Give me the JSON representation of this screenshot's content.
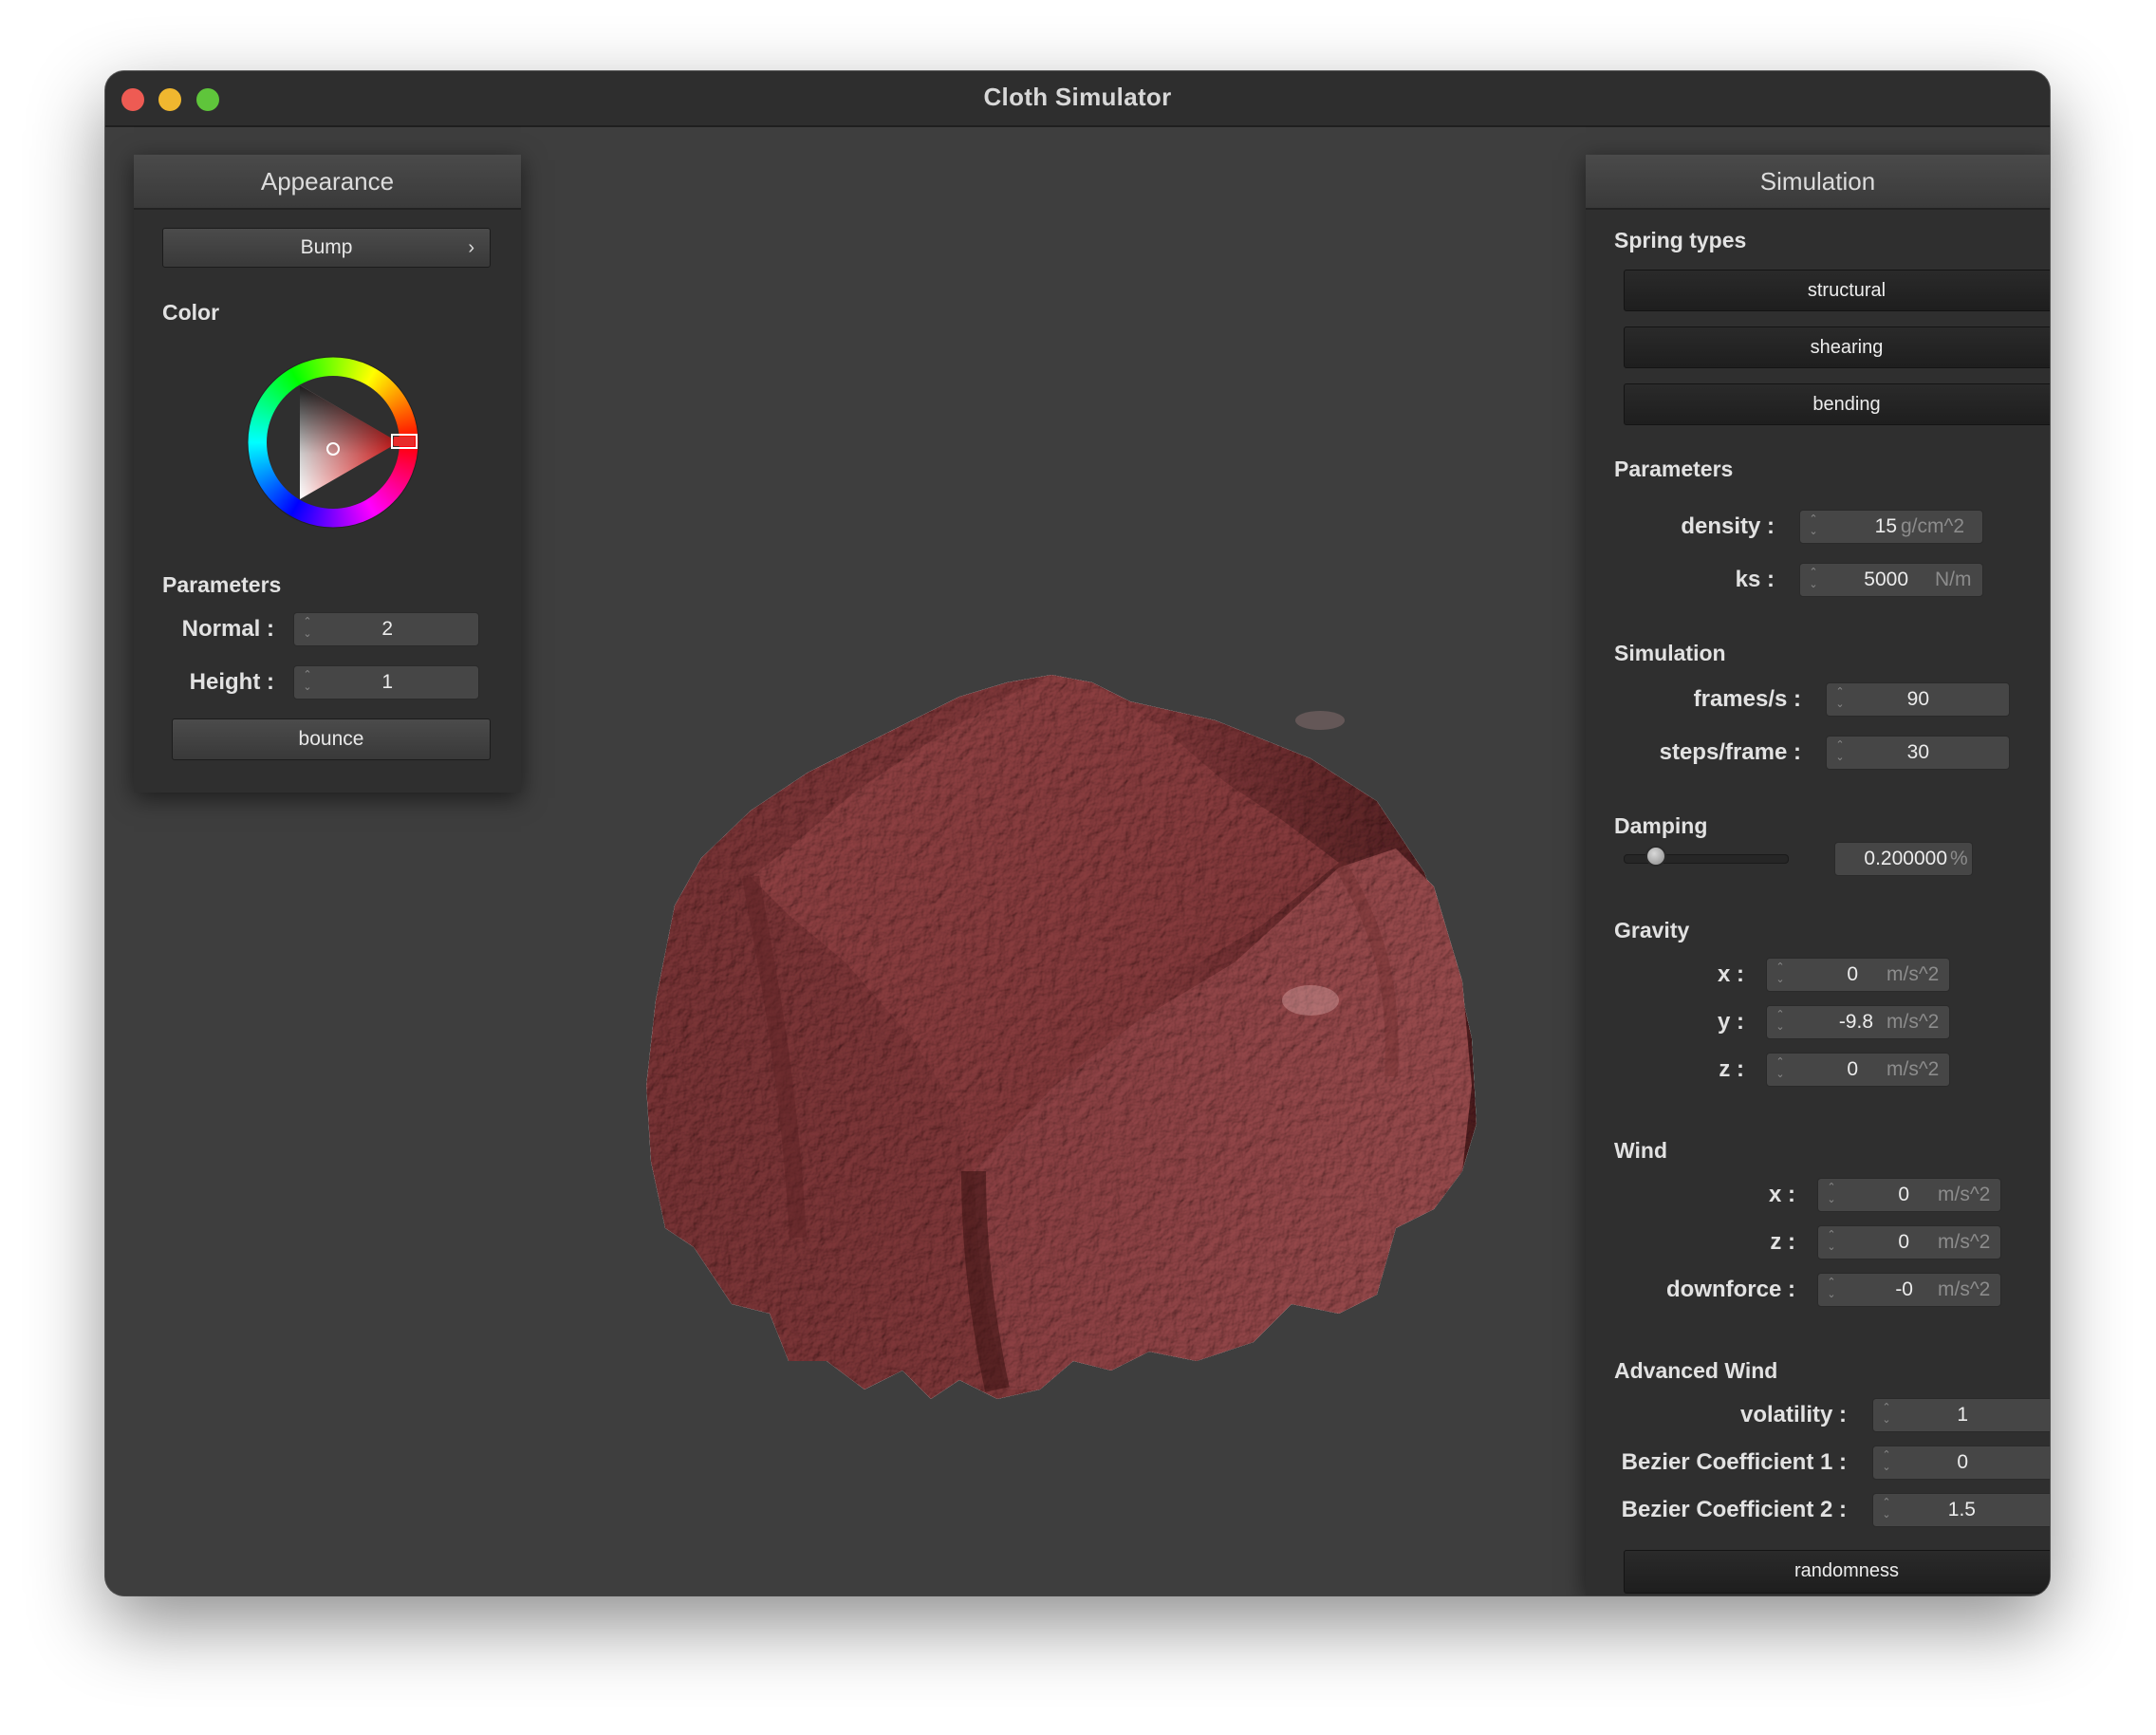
{
  "window": {
    "title": "Cloth Simulator"
  },
  "appearance": {
    "header": "Appearance",
    "shader_button": "Bump",
    "color_label": "Color",
    "parameters_label": "Parameters",
    "normal": {
      "label": "Normal :",
      "value": "2"
    },
    "height": {
      "label": "Height :",
      "value": "1"
    },
    "bounce_button": "bounce",
    "selected_color": "#a84a4a"
  },
  "simulation": {
    "header": "Simulation",
    "spring_types_label": "Spring types",
    "spring_buttons": [
      "structural",
      "shearing",
      "bending"
    ],
    "parameters_label": "Parameters",
    "density": {
      "label": "density :",
      "value": "15",
      "unit": "g/cm^2"
    },
    "ks": {
      "label": "ks :",
      "value": "5000",
      "unit": "N/m"
    },
    "simulation_label": "Simulation",
    "frames_per_s": {
      "label": "frames/s :",
      "value": "90"
    },
    "steps_per_frame": {
      "label": "steps/frame :",
      "value": "30"
    },
    "damping_label": "Damping",
    "damping": {
      "value": "0.200000",
      "unit": "%",
      "slider_fraction": 0.2
    },
    "gravity_label": "Gravity",
    "gravity": {
      "x": {
        "label": "x :",
        "value": "0",
        "unit": "m/s^2"
      },
      "y": {
        "label": "y :",
        "value": "-9.8",
        "unit": "m/s^2"
      },
      "z": {
        "label": "z :",
        "value": "0",
        "unit": "m/s^2"
      }
    },
    "wind_label": "Wind",
    "wind": {
      "x": {
        "label": "x :",
        "value": "0",
        "unit": "m/s^2"
      },
      "z": {
        "label": "z :",
        "value": "0",
        "unit": "m/s^2"
      },
      "downforce": {
        "label": "downforce :",
        "value": "-0",
        "unit": "m/s^2"
      }
    },
    "advanced_wind_label": "Advanced Wind",
    "advanced_wind": {
      "volatility": {
        "label": "volatility :",
        "value": "1"
      },
      "bezier1": {
        "label": "Bezier Coefficient 1 :",
        "value": "0"
      },
      "bezier2": {
        "label": "Bezier Coefficient 2 :",
        "value": "1.5"
      }
    },
    "randomness_button": "randomness"
  },
  "icons": {
    "close": "traffic-light-close",
    "minimize": "traffic-light-minimize",
    "maximize": "traffic-light-maximize",
    "chevron": "chevron-right-icon",
    "color_wheel": "color-wheel-icon"
  },
  "colors": {
    "cloth": "#8a3b3d",
    "background": "#3e3e3e",
    "panel": "#2f2f2f"
  }
}
